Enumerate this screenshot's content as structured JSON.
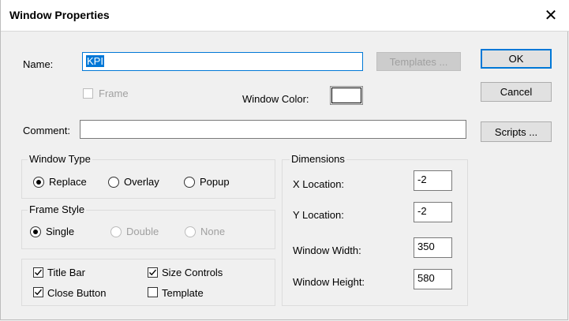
{
  "dialog": {
    "title": "Window Properties",
    "close_glyph": "✕"
  },
  "name": {
    "label": "Name:",
    "value": "KPI"
  },
  "templates_button": "Templates ...",
  "ok_button": "OK",
  "cancel_button": "Cancel",
  "frame": {
    "label": "Frame",
    "checked": false,
    "enabled": false
  },
  "window_color": {
    "label": "Window Color:",
    "color": "#ffffff"
  },
  "comment": {
    "label": "Comment:",
    "value": ""
  },
  "scripts_button": "Scripts ...",
  "window_type": {
    "title": "Window Type",
    "options": [
      {
        "label": "Replace",
        "selected": true
      },
      {
        "label": "Overlay",
        "selected": false
      },
      {
        "label": "Popup",
        "selected": false
      }
    ]
  },
  "frame_style": {
    "title": "Frame Style",
    "options": [
      {
        "label": "Single",
        "selected": true,
        "enabled": true
      },
      {
        "label": "Double",
        "selected": false,
        "enabled": false
      },
      {
        "label": "None",
        "selected": false,
        "enabled": false
      }
    ]
  },
  "options": {
    "title_bar": {
      "label": "Title Bar",
      "checked": true
    },
    "size_controls": {
      "label": "Size Controls",
      "checked": true
    },
    "close_button": {
      "label": "Close Button",
      "checked": true
    },
    "template": {
      "label": "Template",
      "checked": false
    }
  },
  "dimensions": {
    "title": "Dimensions",
    "x_location": {
      "label": "X Location:",
      "value": "-2"
    },
    "y_location": {
      "label": "Y Location:",
      "value": "-2"
    },
    "window_width": {
      "label": "Window Width:",
      "value": "350"
    },
    "window_height": {
      "label": "Window Height:",
      "value": "580"
    }
  }
}
